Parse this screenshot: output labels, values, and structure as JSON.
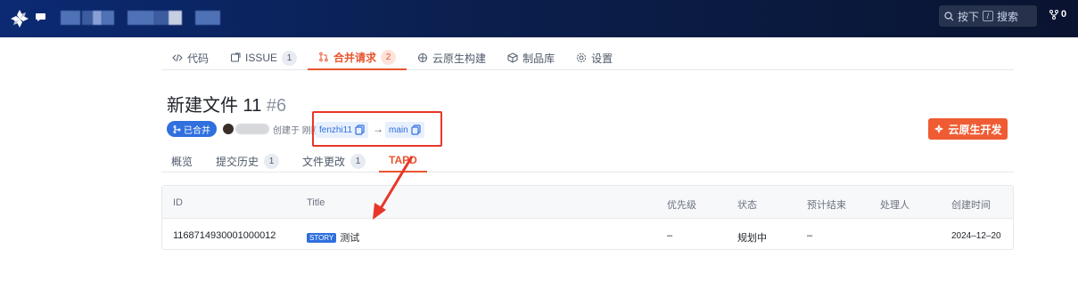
{
  "topbar": {
    "search_label": "按下",
    "search_key": "/",
    "search_action": "搜索",
    "fork_count": "0"
  },
  "repo_nav": [
    {
      "icon": "code-icon",
      "label": "代码",
      "badge": ""
    },
    {
      "icon": "issue-icon",
      "label": "ISSUE",
      "badge": "1"
    },
    {
      "icon": "pull-request-icon",
      "label": "合并请求",
      "badge": "2",
      "active": true
    },
    {
      "icon": "cloud-build-icon",
      "label": "云原生构建",
      "badge": ""
    },
    {
      "icon": "package-icon",
      "label": "制品库",
      "badge": ""
    },
    {
      "icon": "settings-icon",
      "label": "设置",
      "badge": ""
    }
  ],
  "pr": {
    "title": "新建文件 11",
    "number": "#6",
    "status": "已合并",
    "created_text": "创建于 刚刚",
    "source_branch": "fenzhi11",
    "arrow": "→",
    "target_branch": "main",
    "cloud_dev_button": "云原生开发"
  },
  "subtabs": [
    {
      "label": "概览",
      "badge": ""
    },
    {
      "label": "提交历史",
      "badge": "1"
    },
    {
      "label": "文件更改",
      "badge": "1"
    },
    {
      "label": "TAPD",
      "badge": "",
      "active": true
    }
  ],
  "table": {
    "columns": [
      "ID",
      "Title",
      "优先级",
      "状态",
      "预计结束",
      "处理人",
      "创建时间"
    ],
    "rows": [
      {
        "id": "1168714930001000012",
        "tag": "STORY",
        "title": "测试",
        "priority": "–",
        "status": "规划中",
        "due": "–",
        "assignee": "",
        "created": "2024–12–20"
      }
    ]
  },
  "colors": {
    "accent": "#e8552f",
    "merged": "#2f6fde",
    "annotation": "#e8362a"
  }
}
